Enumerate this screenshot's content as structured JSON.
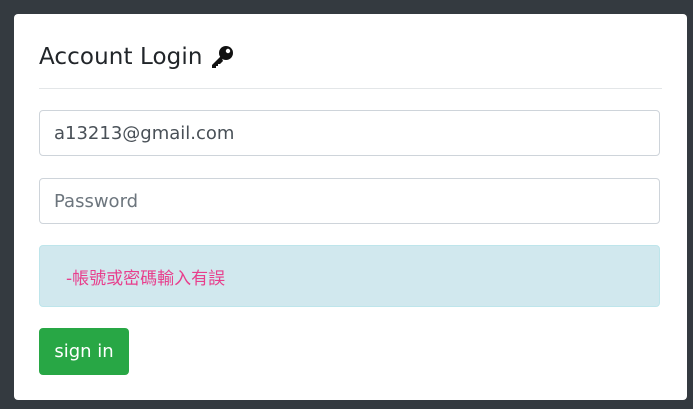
{
  "login": {
    "title": "Account Login",
    "title_icon": "key-icon",
    "email_value": "a13213@gmail.com",
    "password_placeholder": "Password",
    "error_message": "-帳號或密碼輸入有誤",
    "signin_label": "sign in"
  },
  "colors": {
    "page_background": "#343a40",
    "card_background": "#ffffff",
    "alert_background": "#d1e8ee",
    "error_text": "#e83e8c",
    "button_background": "#28a745"
  }
}
